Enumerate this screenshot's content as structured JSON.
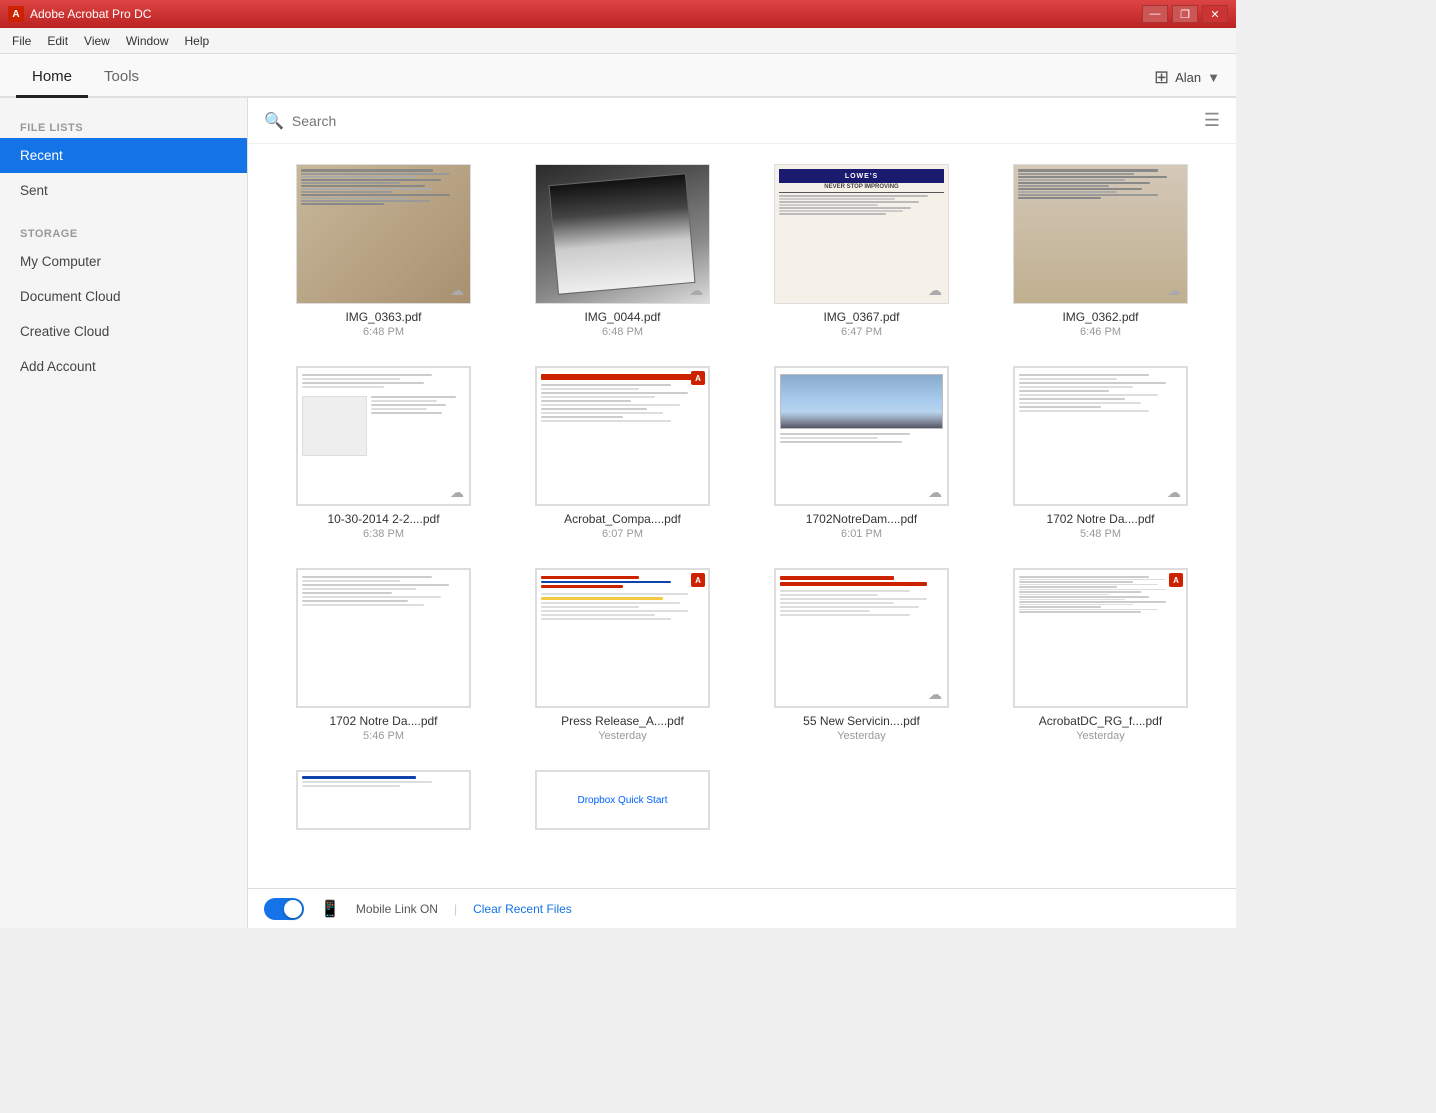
{
  "titlebar": {
    "icon": "A",
    "title": "Adobe Acrobat Pro DC",
    "controls": {
      "minimize": "—",
      "restore": "❐",
      "close": "✕"
    }
  },
  "menubar": {
    "items": [
      "File",
      "Edit",
      "View",
      "Window",
      "Help"
    ]
  },
  "tabs": {
    "active": "Home",
    "items": [
      "Home",
      "Tools"
    ]
  },
  "user": {
    "name": "Alan",
    "icon": "▼"
  },
  "sidebar": {
    "file_lists_label": "FILE LISTS",
    "storage_label": "STORAGE",
    "items": [
      {
        "id": "recent",
        "label": "Recent",
        "active": true
      },
      {
        "id": "sent",
        "label": "Sent",
        "active": false
      }
    ],
    "storage_items": [
      {
        "id": "my-computer",
        "label": "My Computer",
        "active": false
      },
      {
        "id": "document-cloud",
        "label": "Document Cloud",
        "active": false
      },
      {
        "id": "creative-cloud",
        "label": "Creative Cloud",
        "active": false
      },
      {
        "id": "add-account",
        "label": "Add Account",
        "active": false
      }
    ]
  },
  "search": {
    "placeholder": "Search"
  },
  "files": [
    {
      "id": 1,
      "name": "IMG_0363.pdf",
      "time": "6:48 PM",
      "type": "receipt-dark",
      "cloud": true
    },
    {
      "id": 2,
      "name": "IMG_0044.pdf",
      "time": "6:48 PM",
      "type": "receipt-photo",
      "cloud": true
    },
    {
      "id": 3,
      "name": "IMG_0367.pdf",
      "time": "6:47 PM",
      "type": "receipt-lowes",
      "cloud": true
    },
    {
      "id": 4,
      "name": "IMG_0362.pdf",
      "time": "6:46 PM",
      "type": "receipt-paper",
      "cloud": true
    },
    {
      "id": 5,
      "name": "10-30-2014 2-2....pdf",
      "time": "6:38 PM",
      "type": "doc-plain",
      "cloud": true
    },
    {
      "id": 6,
      "name": "Acrobat_Compa....pdf",
      "time": "6:07 PM",
      "type": "doc-adobe",
      "cloud": false,
      "adobe": true
    },
    {
      "id": 7,
      "name": "1702NotreDam....pdf",
      "time": "6:01 PM",
      "type": "doc-photo",
      "cloud": true
    },
    {
      "id": 8,
      "name": "1702 Notre Da....pdf",
      "time": "5:48 PM",
      "type": "doc-text",
      "cloud": true
    },
    {
      "id": 9,
      "name": "1702 Notre Da....pdf",
      "time": "5:46 PM",
      "type": "doc-text2",
      "cloud": false
    },
    {
      "id": 10,
      "name": "Press Release_A....pdf",
      "time": "Yesterday",
      "type": "doc-colored",
      "cloud": false,
      "adobe": true
    },
    {
      "id": 11,
      "name": "55 New Servicin....pdf",
      "time": "Yesterday",
      "type": "doc-red-header",
      "cloud": true
    },
    {
      "id": 12,
      "name": "AcrobatDC_RG_f....pdf",
      "time": "Yesterday",
      "type": "doc-dense",
      "cloud": false,
      "adobe": true
    }
  ],
  "bottombar": {
    "mobile_link_label": "Mobile Link ON",
    "separator": "|",
    "clear_label": "Clear Recent Files"
  }
}
